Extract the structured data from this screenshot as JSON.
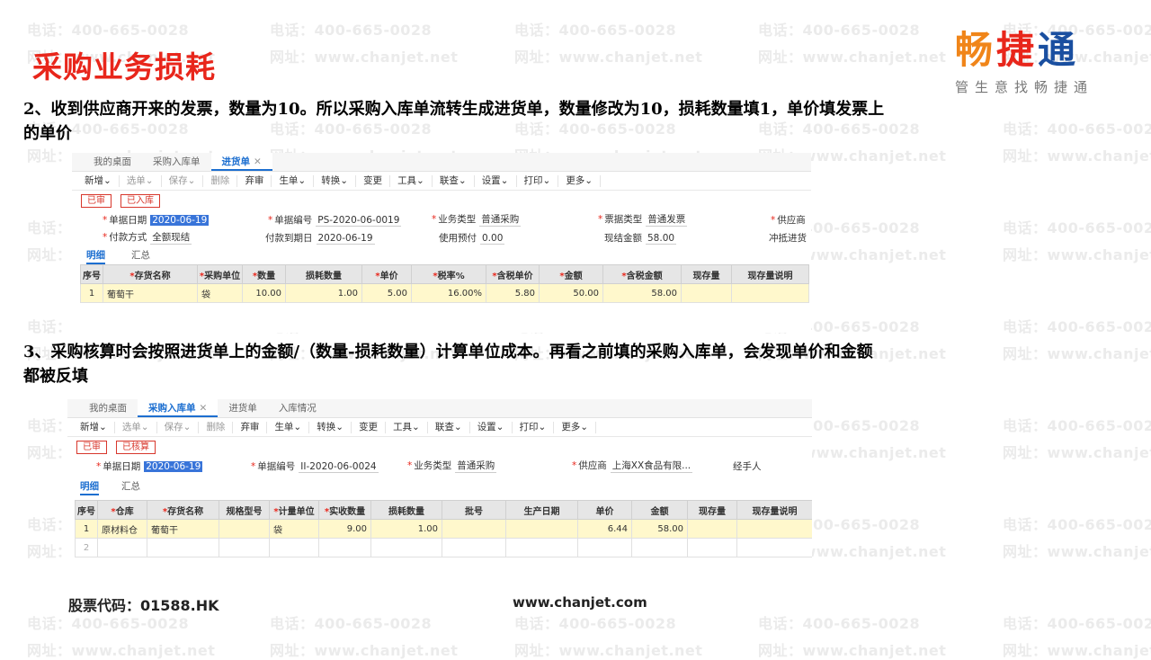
{
  "slide": {
    "title": "采购业务损耗",
    "paragraph1": "2、收到供应商开来的发票，数量为10。所以采购入库单流转生成进货单，数量修改为10，损耗数量填1，单价填发票上的单价",
    "paragraph2": "3、采购核算时会按照进货单上的金额/（数量-损耗数量）计算单位成本。再看之前填的采购入库单，会发现单价和金额都被反填",
    "footer_stock": "股票代码：01588.HK",
    "footer_url": "www.chanjet.com"
  },
  "logo": {
    "c1": "畅",
    "c2": "捷",
    "c3": "通",
    "tagline": "管生意找畅捷通"
  },
  "watermark": {
    "phone": "电话：400-665-0028",
    "site": "网址：www.chanjet.net"
  },
  "win1": {
    "tabs": [
      "我的桌面",
      "采购入库单",
      "进货单"
    ],
    "close": "✕",
    "toolbar": [
      "新增⌄",
      "选单⌄",
      "保存⌄",
      "删除",
      "弃审",
      "生单⌄",
      "转换⌄",
      "变更",
      "工具⌄",
      "联查⌄",
      "设置⌄",
      "打印⌄",
      "更多⌄"
    ],
    "status": [
      "已审",
      "已入库"
    ],
    "row1": {
      "date_label": "单据日期",
      "date_value": "2020-06-19",
      "no_label": "单据编号",
      "no_value": "PS-2020-06-0019",
      "biz_label": "业务类型",
      "biz_value": "普通采购",
      "bill_label": "票据类型",
      "bill_value": "普通发票",
      "supplier_label": "供应商"
    },
    "row2": {
      "pay_label": "付款方式",
      "pay_value": "全额现结",
      "due_label": "付款到期日",
      "due_value": "2020-06-19",
      "prepay_label": "使用预付",
      "prepay_value": "0.00",
      "cash_label": "现结金额",
      "cash_value": "58.00",
      "offset_label": "冲抵进货"
    },
    "subtabs": [
      "明细",
      "汇总"
    ],
    "headers": [
      "序号",
      "存货名称",
      "采购单位",
      "数量",
      "损耗数量",
      "单价",
      "税率%",
      "含税单价",
      "金额",
      "含税金额",
      "现存量",
      "现存量说明"
    ],
    "required": [
      false,
      true,
      true,
      true,
      false,
      true,
      true,
      true,
      true,
      true,
      false,
      false
    ],
    "rows": [
      [
        "1",
        "葡萄干",
        "袋",
        "10.00",
        "1.00",
        "5.00",
        "16.00%",
        "5.80",
        "50.00",
        "58.00",
        "",
        ""
      ]
    ]
  },
  "win2": {
    "tabs": [
      "我的桌面",
      "采购入库单",
      "进货单",
      "入库情况"
    ],
    "close": "✕",
    "toolbar": [
      "新增⌄",
      "选单⌄",
      "保存⌄",
      "删除",
      "弃审",
      "生单⌄",
      "转换⌄",
      "变更",
      "工具⌄",
      "联查⌄",
      "设置⌄",
      "打印⌄",
      "更多⌄"
    ],
    "status": [
      "已审",
      "已核算"
    ],
    "row1": {
      "date_label": "单据日期",
      "date_value": "2020-06-19",
      "no_label": "单据编号",
      "no_value": "II-2020-06-0024",
      "biz_label": "业务类型",
      "biz_value": "普通采购",
      "supplier_label": "供应商",
      "supplier_value": "上海XX食品有限...",
      "handler_label": "经手人"
    },
    "subtabs": [
      "明细",
      "汇总"
    ],
    "headers": [
      "序号",
      "仓库",
      "存货名称",
      "规格型号",
      "计量单位",
      "实收数量",
      "损耗数量",
      "批号",
      "生产日期",
      "单价",
      "金额",
      "现存量",
      "现存量说明"
    ],
    "required": [
      false,
      true,
      true,
      false,
      true,
      true,
      false,
      false,
      false,
      false,
      false,
      false,
      false
    ],
    "rows": [
      [
        "1",
        "原材料仓",
        "葡萄干",
        "",
        "袋",
        "9.00",
        "1.00",
        "",
        "",
        "6.44",
        "58.00",
        "",
        ""
      ],
      [
        "2",
        "",
        "",
        "",
        "",
        "",
        "",
        "",
        "",
        "",
        "",
        "",
        ""
      ]
    ]
  }
}
